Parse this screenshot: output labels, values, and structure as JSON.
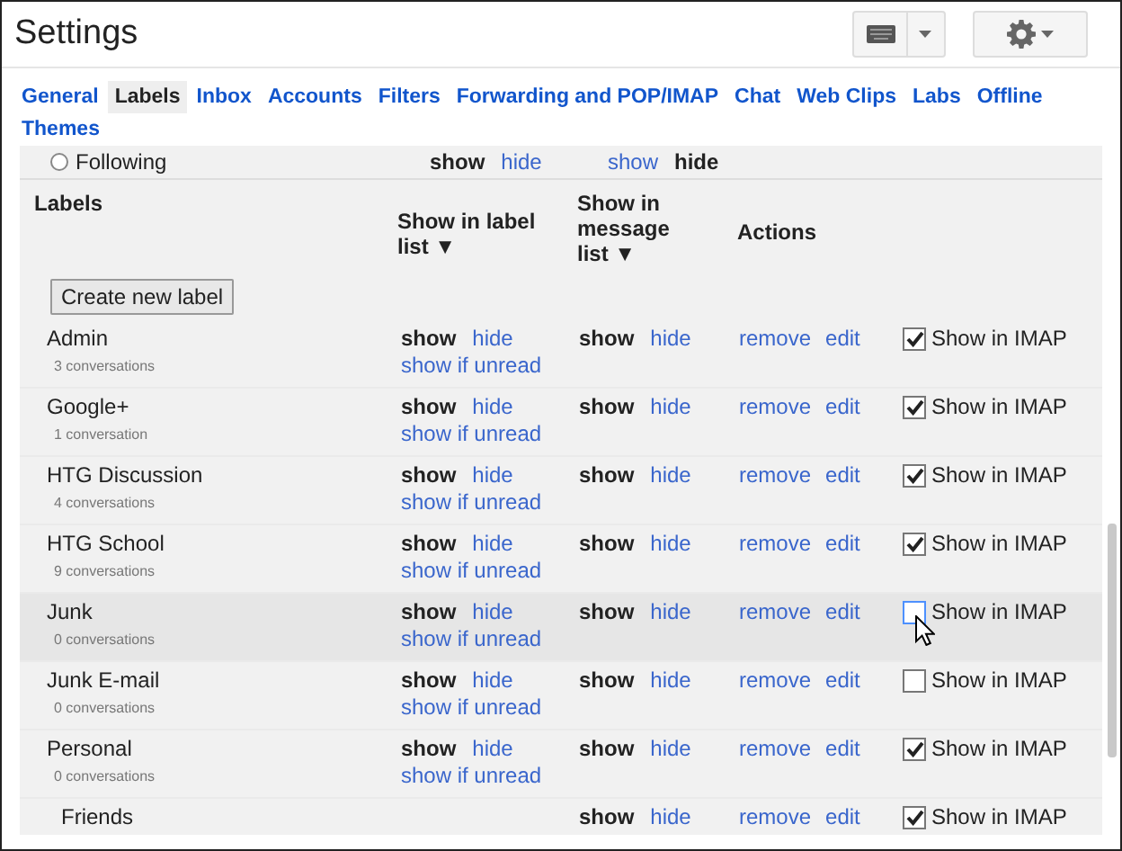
{
  "window": {
    "title": "Settings"
  },
  "tabs": [
    {
      "label": "General",
      "selected": false
    },
    {
      "label": "Labels",
      "selected": true
    },
    {
      "label": "Inbox",
      "selected": false
    },
    {
      "label": "Accounts",
      "selected": false
    },
    {
      "label": "Filters",
      "selected": false
    },
    {
      "label": "Forwarding and POP/IMAP",
      "selected": false
    },
    {
      "label": "Chat",
      "selected": false
    },
    {
      "label": "Web Clips",
      "selected": false
    },
    {
      "label": "Labs",
      "selected": false
    },
    {
      "label": "Offline",
      "selected": false
    },
    {
      "label": "Themes",
      "selected": false
    }
  ],
  "partial_row": {
    "name": "Following",
    "selected": false,
    "label_list": [
      {
        "text": "show",
        "selected": true
      },
      {
        "text": "hide",
        "selected": false
      }
    ],
    "message_list": [
      {
        "text": "show",
        "selected": false
      },
      {
        "text": "hide",
        "selected": true
      }
    ]
  },
  "labels_header": {
    "title": "Labels",
    "label_list_heading": "Show in label list ▼",
    "message_list_heading": "Show in message list ▼",
    "actions_heading": "Actions"
  },
  "create_button": "Create new label",
  "labels": [
    {
      "name": "Admin",
      "count": "3 conversations",
      "hovered": false,
      "label_list": [
        {
          "text": "show",
          "selected": true
        },
        {
          "text": "hide",
          "selected": false
        }
      ],
      "show_if_unread": "show if unread",
      "message_list": [
        {
          "text": "show",
          "selected": true
        },
        {
          "text": "hide",
          "selected": false
        }
      ],
      "actions": [
        "remove",
        "edit"
      ],
      "imap": {
        "label": "Show in IMAP",
        "checked": true
      }
    },
    {
      "name": "Google+",
      "count": "1 conversation",
      "hovered": false,
      "label_list": [
        {
          "text": "show",
          "selected": true
        },
        {
          "text": "hide",
          "selected": false
        }
      ],
      "show_if_unread": "show if unread",
      "message_list": [
        {
          "text": "show",
          "selected": true
        },
        {
          "text": "hide",
          "selected": false
        }
      ],
      "actions": [
        "remove",
        "edit"
      ],
      "imap": {
        "label": "Show in IMAP",
        "checked": true
      }
    },
    {
      "name": "HTG Discussion",
      "count": "4 conversations",
      "hovered": false,
      "label_list": [
        {
          "text": "show",
          "selected": true
        },
        {
          "text": "hide",
          "selected": false
        }
      ],
      "show_if_unread": "show if unread",
      "message_list": [
        {
          "text": "show",
          "selected": true
        },
        {
          "text": "hide",
          "selected": false
        }
      ],
      "actions": [
        "remove",
        "edit"
      ],
      "imap": {
        "label": "Show in IMAP",
        "checked": true
      }
    },
    {
      "name": "HTG School",
      "count": "9 conversations",
      "hovered": false,
      "label_list": [
        {
          "text": "show",
          "selected": true
        },
        {
          "text": "hide",
          "selected": false
        }
      ],
      "show_if_unread": "show if unread",
      "message_list": [
        {
          "text": "show",
          "selected": true
        },
        {
          "text": "hide",
          "selected": false
        }
      ],
      "actions": [
        "remove",
        "edit"
      ],
      "imap": {
        "label": "Show in IMAP",
        "checked": true
      }
    },
    {
      "name": "Junk",
      "count": "0 conversations",
      "hovered": true,
      "label_list": [
        {
          "text": "show",
          "selected": true
        },
        {
          "text": "hide",
          "selected": false
        }
      ],
      "show_if_unread": "show if unread",
      "message_list": [
        {
          "text": "show",
          "selected": true
        },
        {
          "text": "hide",
          "selected": false
        }
      ],
      "actions": [
        "remove",
        "edit"
      ],
      "imap": {
        "label": "Show in IMAP",
        "checked": false
      }
    },
    {
      "name": "Junk E-mail",
      "count": "0 conversations",
      "hovered": false,
      "label_list": [
        {
          "text": "show",
          "selected": true
        },
        {
          "text": "hide",
          "selected": false
        }
      ],
      "show_if_unread": "show if unread",
      "message_list": [
        {
          "text": "show",
          "selected": true
        },
        {
          "text": "hide",
          "selected": false
        }
      ],
      "actions": [
        "remove",
        "edit"
      ],
      "imap": {
        "label": "Show in IMAP",
        "checked": false
      }
    },
    {
      "name": "Personal",
      "count": "0 conversations",
      "hovered": false,
      "label_list": [
        {
          "text": "show",
          "selected": true
        },
        {
          "text": "hide",
          "selected": false
        }
      ],
      "show_if_unread": "show if unread",
      "message_list": [
        {
          "text": "show",
          "selected": true
        },
        {
          "text": "hide",
          "selected": false
        }
      ],
      "actions": [
        "remove",
        "edit"
      ],
      "imap": {
        "label": "Show in IMAP",
        "checked": true
      },
      "children": [
        {
          "name": "Friends",
          "hovered": false,
          "message_list": [
            {
              "text": "show",
              "selected": true
            },
            {
              "text": "hide",
              "selected": false
            }
          ],
          "actions": [
            "remove",
            "edit"
          ],
          "imap": {
            "label": "Show in IMAP",
            "checked": true
          }
        }
      ]
    }
  ]
}
